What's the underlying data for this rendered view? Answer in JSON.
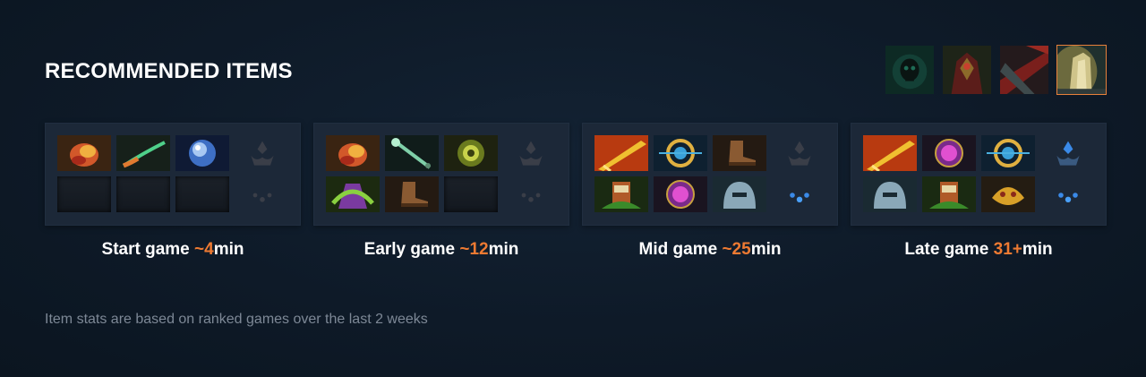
{
  "section": {
    "title": "RECOMMENDED ITEMS"
  },
  "hero_portraits": [
    {
      "icon": "dark-skull-hero-icon",
      "active": false
    },
    {
      "icon": "crimson-armored-hero-icon",
      "active": false
    },
    {
      "icon": "red-blade-hero-icon",
      "active": false
    },
    {
      "icon": "golden-tower-hero-icon",
      "active": true
    }
  ],
  "phases": [
    {
      "label": "Start game",
      "time_prefix": "~",
      "time_value": "4",
      "time_suffix": "min",
      "items": [
        "orange-tango-item-icon",
        "healing-branch-item-icon",
        "blue-orb-item-icon",
        "empty",
        "empty",
        "empty"
      ],
      "neutral_tier": "dim"
    },
    {
      "label": "Early game",
      "time_prefix": "~",
      "time_value": "12",
      "time_suffix": "min",
      "items": [
        "orange-tango-item-icon",
        "green-staff-item-icon",
        "golden-gear-item-icon",
        "green-cloak-item-icon",
        "leather-boots-item-icon",
        "empty"
      ],
      "neutral_tier": "dim"
    },
    {
      "label": "Mid game",
      "time_prefix": "~",
      "time_value": "25",
      "time_suffix": "min",
      "items": [
        "golden-sword-item-icon",
        "blue-gold-amulet-item-icon",
        "leather-boots-item-icon",
        "green-lantern-item-icon",
        "purple-orb-item-icon",
        "silver-helm-item-icon"
      ],
      "neutral_tier": "blue"
    },
    {
      "label": "Late game",
      "time_prefix": "",
      "time_value": "31+",
      "time_suffix": "min",
      "items": [
        "golden-sword-item-icon",
        "purple-orb-item-icon",
        "blue-gold-amulet-item-icon",
        "silver-helm-item-icon",
        "green-lantern-item-icon",
        "golden-mask-item-icon"
      ],
      "neutral_tier": "blue"
    }
  ],
  "footnote": "Item stats are based on ranked games over the last 2 weeks",
  "colors": {
    "accent_orange": "#ee7a32",
    "background": "#0e1a28",
    "panel": "#1c2838"
  }
}
